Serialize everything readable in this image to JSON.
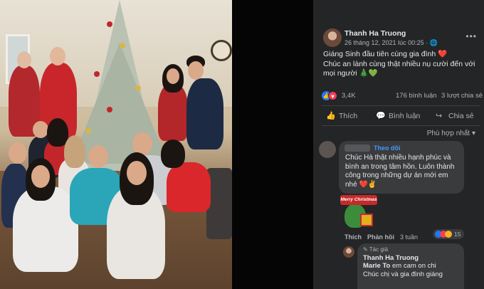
{
  "photo": {
    "alt": "Family photo"
  },
  "post": {
    "author": "Thanh Ha Truong",
    "timestamp": "26 tháng 12, 2021 lúc 00:25 · ",
    "privacy_icon": "globe-icon",
    "more_icon": "•••",
    "text_lines": [
      "Giáng Sinh đầu tiên cùng gia đình ❤️",
      "Chúc an lành cùng thật nhiều nụ cười đến với",
      "mọi người 🎄💚"
    ]
  },
  "reactions": {
    "count": "3,4K",
    "comments": "176 bình luận",
    "shares": "3 lượt chia sẻ"
  },
  "actions": {
    "like": "Thích",
    "comment": "Bình luận",
    "share": "Chia sẻ"
  },
  "sort_label": "Phù hợp nhất ▾",
  "comment": {
    "follow_label": "Theo dõi",
    "text_lines": [
      "Chúc Hà thật nhiều hạnh phúc và",
      "bình an trong tâm hồn. Luôn thành",
      "công trong những dự án mới em",
      "nhé ❤️✌️"
    ],
    "sticker_text": "Merry Christmas",
    "like_label": "Thích",
    "reply_label": "Phản hồi",
    "age": "3 tuần",
    "reaction_count": "15"
  },
  "reply": {
    "tag": "✎ Tác giả",
    "author": "Thanh Ha Truong",
    "mention": "Marie To",
    "text_after_mention": " em cam on chi",
    "line2": "Chúc chị và gia đình giáng"
  },
  "colors": {
    "panel_bg": "#242526",
    "bubble_bg": "#3a3b3c",
    "link_blue": "#4599ff",
    "like_blue": "#2078f4",
    "love_red": "#f33e58"
  }
}
